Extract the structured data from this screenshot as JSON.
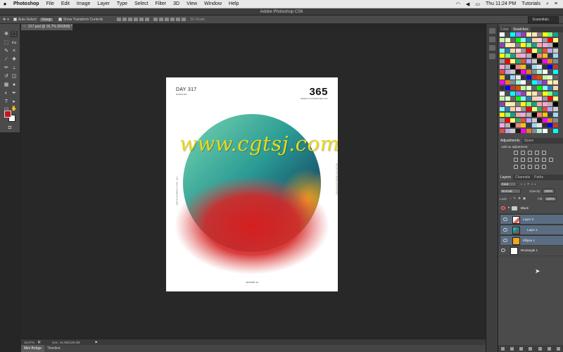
{
  "menubar": {
    "apple": "",
    "app": "Photoshop",
    "items": [
      "File",
      "Edit",
      "Image",
      "Layer",
      "Type",
      "Select",
      "Filter",
      "3D",
      "View",
      "Window",
      "Help"
    ],
    "clock": "Thu 11:24 PM",
    "user": "Tutorials"
  },
  "window": {
    "title": "Adobe Photoshop CS6"
  },
  "options": {
    "auto_select_label": "Auto-Select:",
    "auto_select_value": "Group",
    "show_transform": "Show Transform Controls",
    "mode_3d": "3D Mode:",
    "workspace": "Essentials"
  },
  "document": {
    "tab_title": "317.psd @ 16.7% (RGB/8) *"
  },
  "poster": {
    "day": "DAY 317",
    "sub_left": "MINIMALISM",
    "big": "365",
    "sub_right": "DESIGN A POSTER EVERY DAY",
    "side_left": "MARTIN NAUMANN © 2016 – 2017",
    "side_right": "365 DAYS OF MINIMALISM POSTERS",
    "date": "JANUARY 24"
  },
  "watermark": "www.cgtsj.com",
  "statusbar": {
    "zoom": "16.67%",
    "doc": "Doc: 44.0M/128.3M"
  },
  "bottom_tabs": [
    "Mini Bridge",
    "Timeline"
  ],
  "panels": {
    "color_tabs": [
      "Color",
      "Swatches"
    ],
    "adjust_tabs": [
      "Adjustments",
      "Styles"
    ],
    "adjust_title": "Add an adjustment",
    "layer_tabs": [
      "Layers",
      "Channels",
      "Paths"
    ],
    "kind": "Kind",
    "blend": "Normal",
    "opacity_label": "Opacity:",
    "opacity_value": "100%",
    "lock_label": "Lock:",
    "fill_label": "Fill:",
    "fill_value": "100%",
    "layers": [
      {
        "name": "Black",
        "type": "group",
        "selected": false
      },
      {
        "name": "Layer 3",
        "type": "layer",
        "selected": true
      },
      {
        "name": "Layer 1",
        "type": "layer",
        "selected": true
      },
      {
        "name": "Ellipse 1",
        "type": "shape",
        "selected": true
      },
      {
        "name": "Rectangle 1",
        "type": "shape",
        "selected": false
      }
    ]
  },
  "colors": {
    "foreground": "#c8141a",
    "background": "#ffffff",
    "accent": "#e9d81c",
    "sphere_top": "#5fc9a4",
    "sphere_mid": "#1f7f86",
    "sphere_red": "#d42222",
    "sphere_orange": "#f0a020"
  }
}
